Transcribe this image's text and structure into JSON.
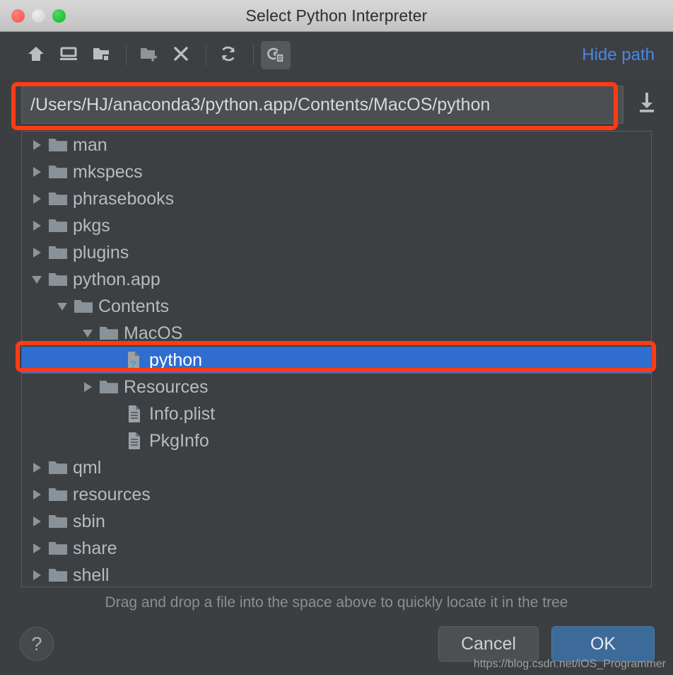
{
  "window": {
    "title": "Select Python Interpreter",
    "traffic_lights": [
      "close-button",
      "minimize-button",
      "zoom-button"
    ]
  },
  "toolbar": {
    "buttons": [
      {
        "name": "home-icon",
        "tooltip": "Home"
      },
      {
        "name": "desktop-icon",
        "tooltip": "Desktop"
      },
      {
        "name": "project-folder-icon",
        "tooltip": "Project Directory"
      },
      {
        "name": "new-folder-icon",
        "tooltip": "New Folder"
      },
      {
        "name": "delete-icon",
        "tooltip": "Delete"
      },
      {
        "name": "refresh-icon",
        "tooltip": "Refresh"
      },
      {
        "name": "show-hidden-files-icon",
        "tooltip": "Show Hidden Files and Directories"
      }
    ],
    "hide_path_label": "Hide path"
  },
  "path_field": {
    "value": "/Users/HJ/anaconda3/python.app/Contents/MacOS/python",
    "placeholder": "",
    "download_icon": "download-icon"
  },
  "tree": {
    "rows": [
      {
        "label": "man",
        "level": 0,
        "twisty": "closed",
        "icon": "folder-icon",
        "selected": false
      },
      {
        "label": "mkspecs",
        "level": 0,
        "twisty": "closed",
        "icon": "folder-icon",
        "selected": false
      },
      {
        "label": "phrasebooks",
        "level": 0,
        "twisty": "closed",
        "icon": "folder-icon",
        "selected": false
      },
      {
        "label": "pkgs",
        "level": 0,
        "twisty": "closed",
        "icon": "folder-icon",
        "selected": false
      },
      {
        "label": "plugins",
        "level": 0,
        "twisty": "closed",
        "icon": "folder-icon",
        "selected": false
      },
      {
        "label": "python.app",
        "level": 0,
        "twisty": "open",
        "icon": "folder-icon",
        "selected": false
      },
      {
        "label": "Contents",
        "level": 1,
        "twisty": "open",
        "icon": "folder-icon",
        "selected": false
      },
      {
        "label": "MacOS",
        "level": 2,
        "twisty": "open",
        "icon": "folder-icon",
        "selected": false
      },
      {
        "label": "python",
        "level": 3,
        "twisty": "none",
        "icon": "unknown-file-icon",
        "selected": true
      },
      {
        "label": "Resources",
        "level": 2,
        "twisty": "closed",
        "icon": "folder-icon",
        "selected": false
      },
      {
        "label": "Info.plist",
        "level": 3,
        "twisty": "none",
        "icon": "text-file-icon",
        "selected": false
      },
      {
        "label": "PkgInfo",
        "level": 3,
        "twisty": "none",
        "icon": "text-file-icon",
        "selected": false
      },
      {
        "label": "qml",
        "level": 0,
        "twisty": "closed",
        "icon": "folder-icon",
        "selected": false
      },
      {
        "label": "resources",
        "level": 0,
        "twisty": "closed",
        "icon": "folder-icon",
        "selected": false
      },
      {
        "label": "sbin",
        "level": 0,
        "twisty": "closed",
        "icon": "folder-icon",
        "selected": false
      },
      {
        "label": "share",
        "level": 0,
        "twisty": "closed",
        "icon": "folder-icon",
        "selected": false
      },
      {
        "label": "shell",
        "level": 0,
        "twisty": "closed",
        "icon": "folder-icon",
        "selected": false
      },
      {
        "label": "",
        "level": 0,
        "twisty": "closed",
        "icon": "folder-icon",
        "selected": false
      }
    ]
  },
  "hint": "Drag and drop a file into the space above to quickly locate it in the tree",
  "footer": {
    "help_label": "?",
    "cancel_label": "Cancel",
    "ok_label": "OK"
  },
  "watermark": "https://blog.csdn.net/iOS_Programmer",
  "colors": {
    "window_bg": "#3c4043",
    "titlebar": "#cdcdcd",
    "selection_blue": "#2f6dd0",
    "link_blue": "#4a86e8",
    "ok_blue": "#3c6a99",
    "annotation_red": "#ff3b16",
    "folder_grey": "#8a9299",
    "text_grey": "#b6bbbf"
  }
}
